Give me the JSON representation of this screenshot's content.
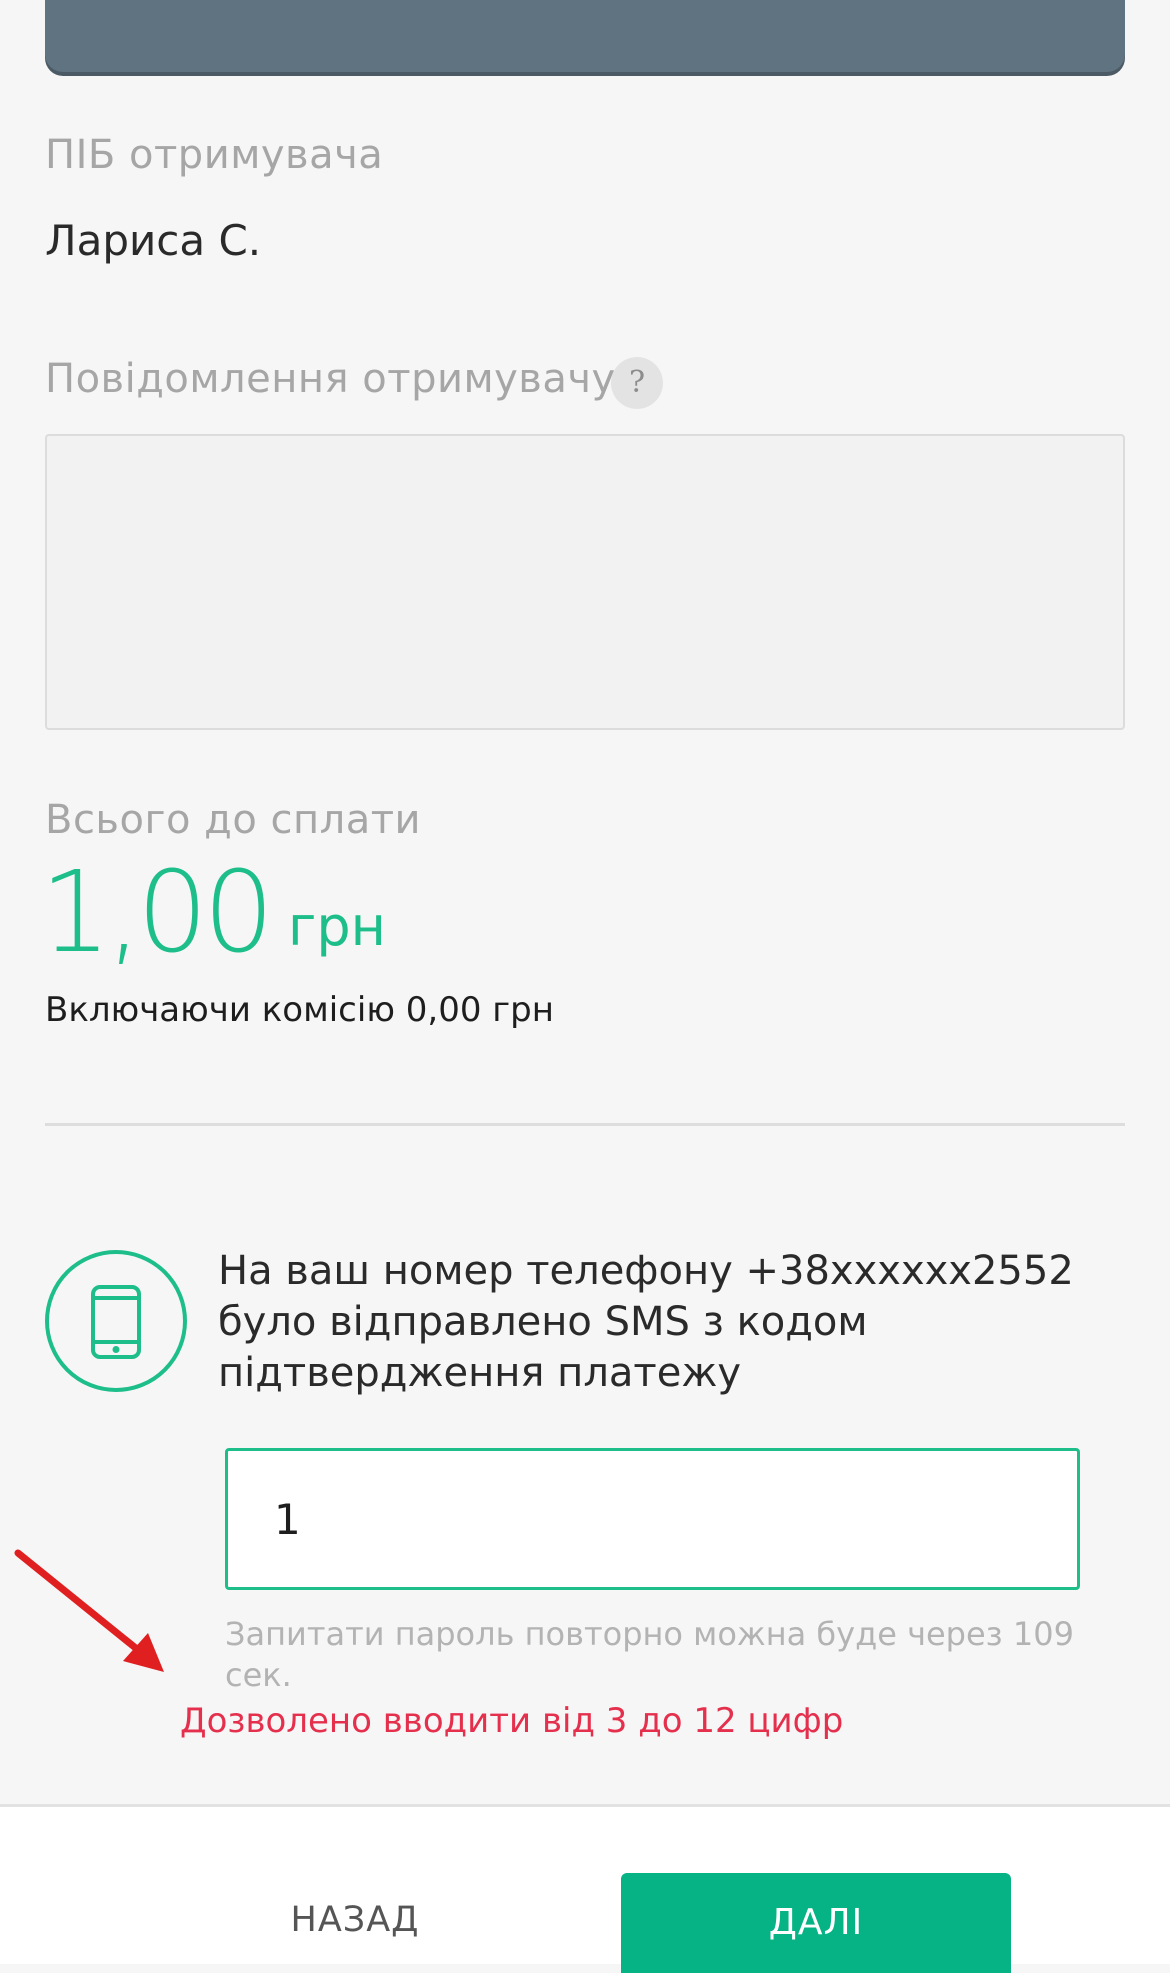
{
  "recipient": {
    "label": "ПІБ отримувача",
    "name": "Лариса С."
  },
  "message": {
    "label": "Повідомлення отримувачу",
    "help_icon_text": "?",
    "value": ""
  },
  "total": {
    "label": "Всього до сплати",
    "amount": "1,00",
    "currency": "грн",
    "commission": "Включаючи комісію 0,00 грн"
  },
  "confirmation": {
    "icon": "smartphone-icon",
    "text": "На ваш номер телефону +38xxxxxx2552 було відправлено SMS з кодом підтвердження платежу",
    "code_value": "1",
    "resend_info": "Запитати пароль повторно можна буде через 109 сек.",
    "error": "Дозволено вводити від 3 до 12 цифр"
  },
  "footer": {
    "back_label": "НАЗАД",
    "next_label": "ДАЛІ"
  },
  "colors": {
    "accent": "#1ebe8a",
    "button": "#06b384",
    "error": "#e5304d",
    "annotation_arrow": "#e02020"
  }
}
